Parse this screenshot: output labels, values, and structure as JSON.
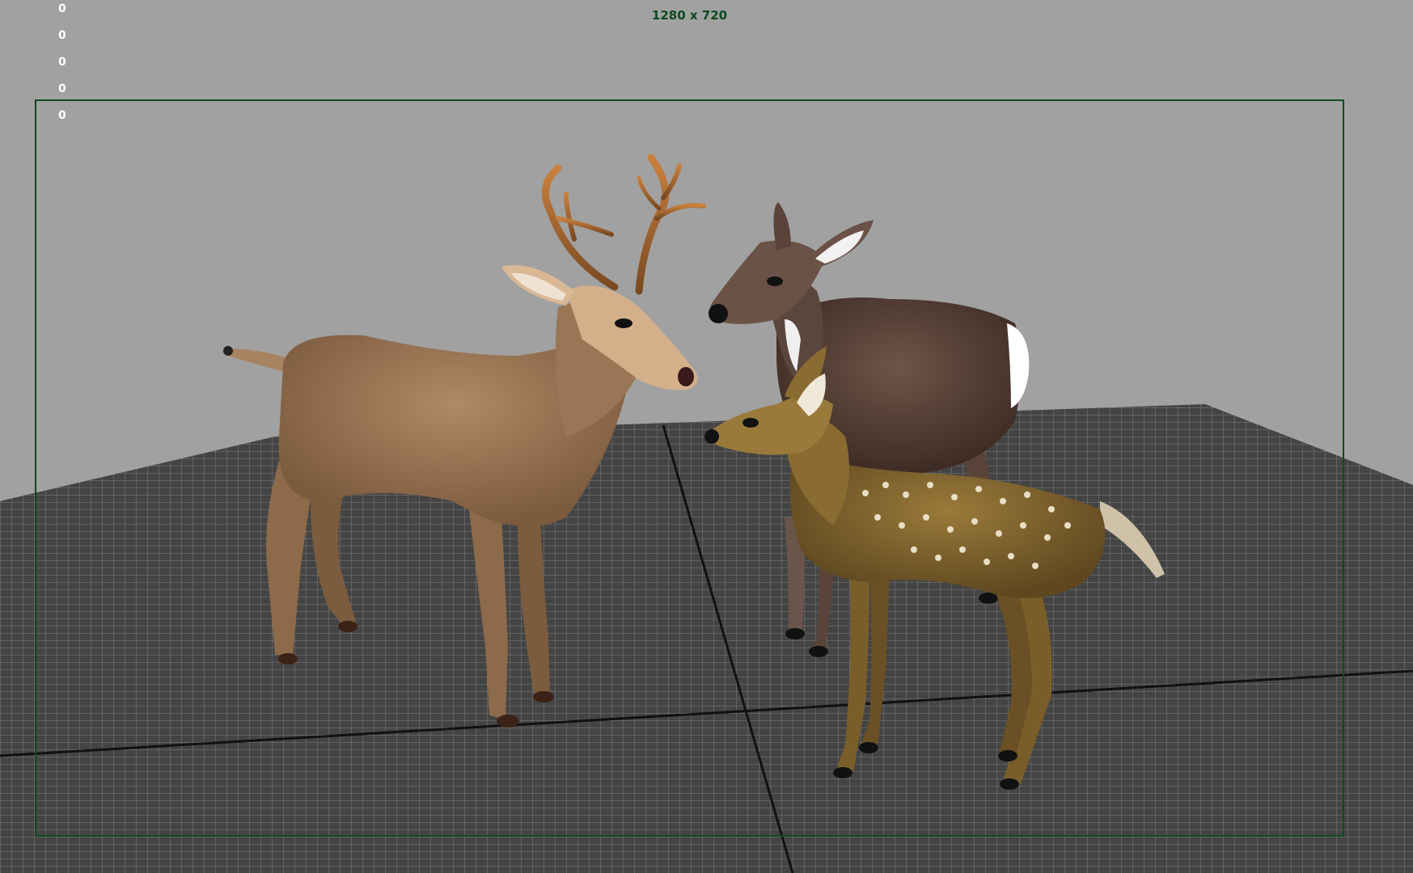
{
  "viewport": {
    "resolution_label": "1280 x 720",
    "hud_counters": [
      "0",
      "0",
      "0",
      "0",
      "0"
    ],
    "colors": {
      "background": "#a1a1a1",
      "grid_floor": "#4a4a4a",
      "grid_lines": "#8e8e8e",
      "resolution_gate": "#0e4a22",
      "resolution_text": "#0b4a1f"
    },
    "objects": [
      {
        "name": "buck",
        "description": "adult deer with antlers"
      },
      {
        "name": "doe",
        "description": "dark brown doe"
      },
      {
        "name": "fawn",
        "description": "spotted fawn"
      }
    ]
  }
}
